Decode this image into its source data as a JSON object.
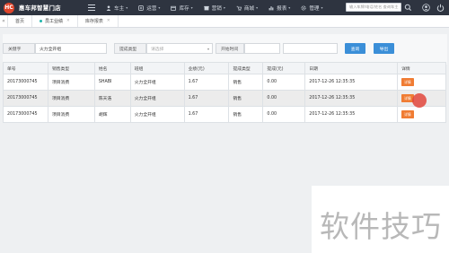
{
  "app": {
    "logo_text": "HC",
    "title": "惠车邦智慧门店"
  },
  "nav": {
    "items": [
      {
        "label": "车主",
        "icon": "car-owner-icon"
      },
      {
        "label": "运营",
        "icon": "operations-icon"
      },
      {
        "label": "库存",
        "icon": "inventory-icon"
      },
      {
        "label": "营销",
        "icon": "marketing-icon"
      },
      {
        "label": "商城",
        "icon": "mall-icon"
      },
      {
        "label": "报表",
        "icon": "report-icon"
      },
      {
        "label": "管理",
        "icon": "settings-icon"
      }
    ],
    "search_placeholder": "输入车牌/电话/姓名 查询车主"
  },
  "tabs": [
    {
      "label": "首页"
    },
    {
      "label": "员工业绩"
    },
    {
      "label": "库存报表"
    }
  ],
  "filters": {
    "keyword_label": "关键字",
    "keyword_value": "火力全开组",
    "type_label": "提成类型",
    "type_placeholder": "请选择",
    "start_label": "开始时间",
    "start_value": "",
    "end_value": "",
    "search_button": "查询",
    "export_button": "导出"
  },
  "table": {
    "columns": [
      "单号",
      "销售类型",
      "姓名",
      "班组",
      "业绩(元)",
      "提成类型",
      "提成(元)",
      "日期",
      "详情"
    ],
    "rows": [
      [
        "20173000745",
        "项目消费",
        "SHABI",
        "火力全开组",
        "1.67",
        "销售",
        "0.00",
        "2017-12-26 12:35:35",
        "详情"
      ],
      [
        "20173000745",
        "项目消费",
        "陈天浩",
        "火力全开组",
        "1.67",
        "销售",
        "0.00",
        "2017-12-26 12:35:35",
        "详情"
      ],
      [
        "20173000745",
        "项目消费",
        "胡辉",
        "火力全开组",
        "1.67",
        "销售",
        "0.00",
        "2017-12-26 12:35:35",
        "详情"
      ]
    ]
  },
  "watermark": "软件技巧",
  "colors": {
    "topbar": "#2e3440",
    "brand_red": "#e0452b",
    "primary_button": "#3b8fd8",
    "detail_button": "#f07c33"
  }
}
